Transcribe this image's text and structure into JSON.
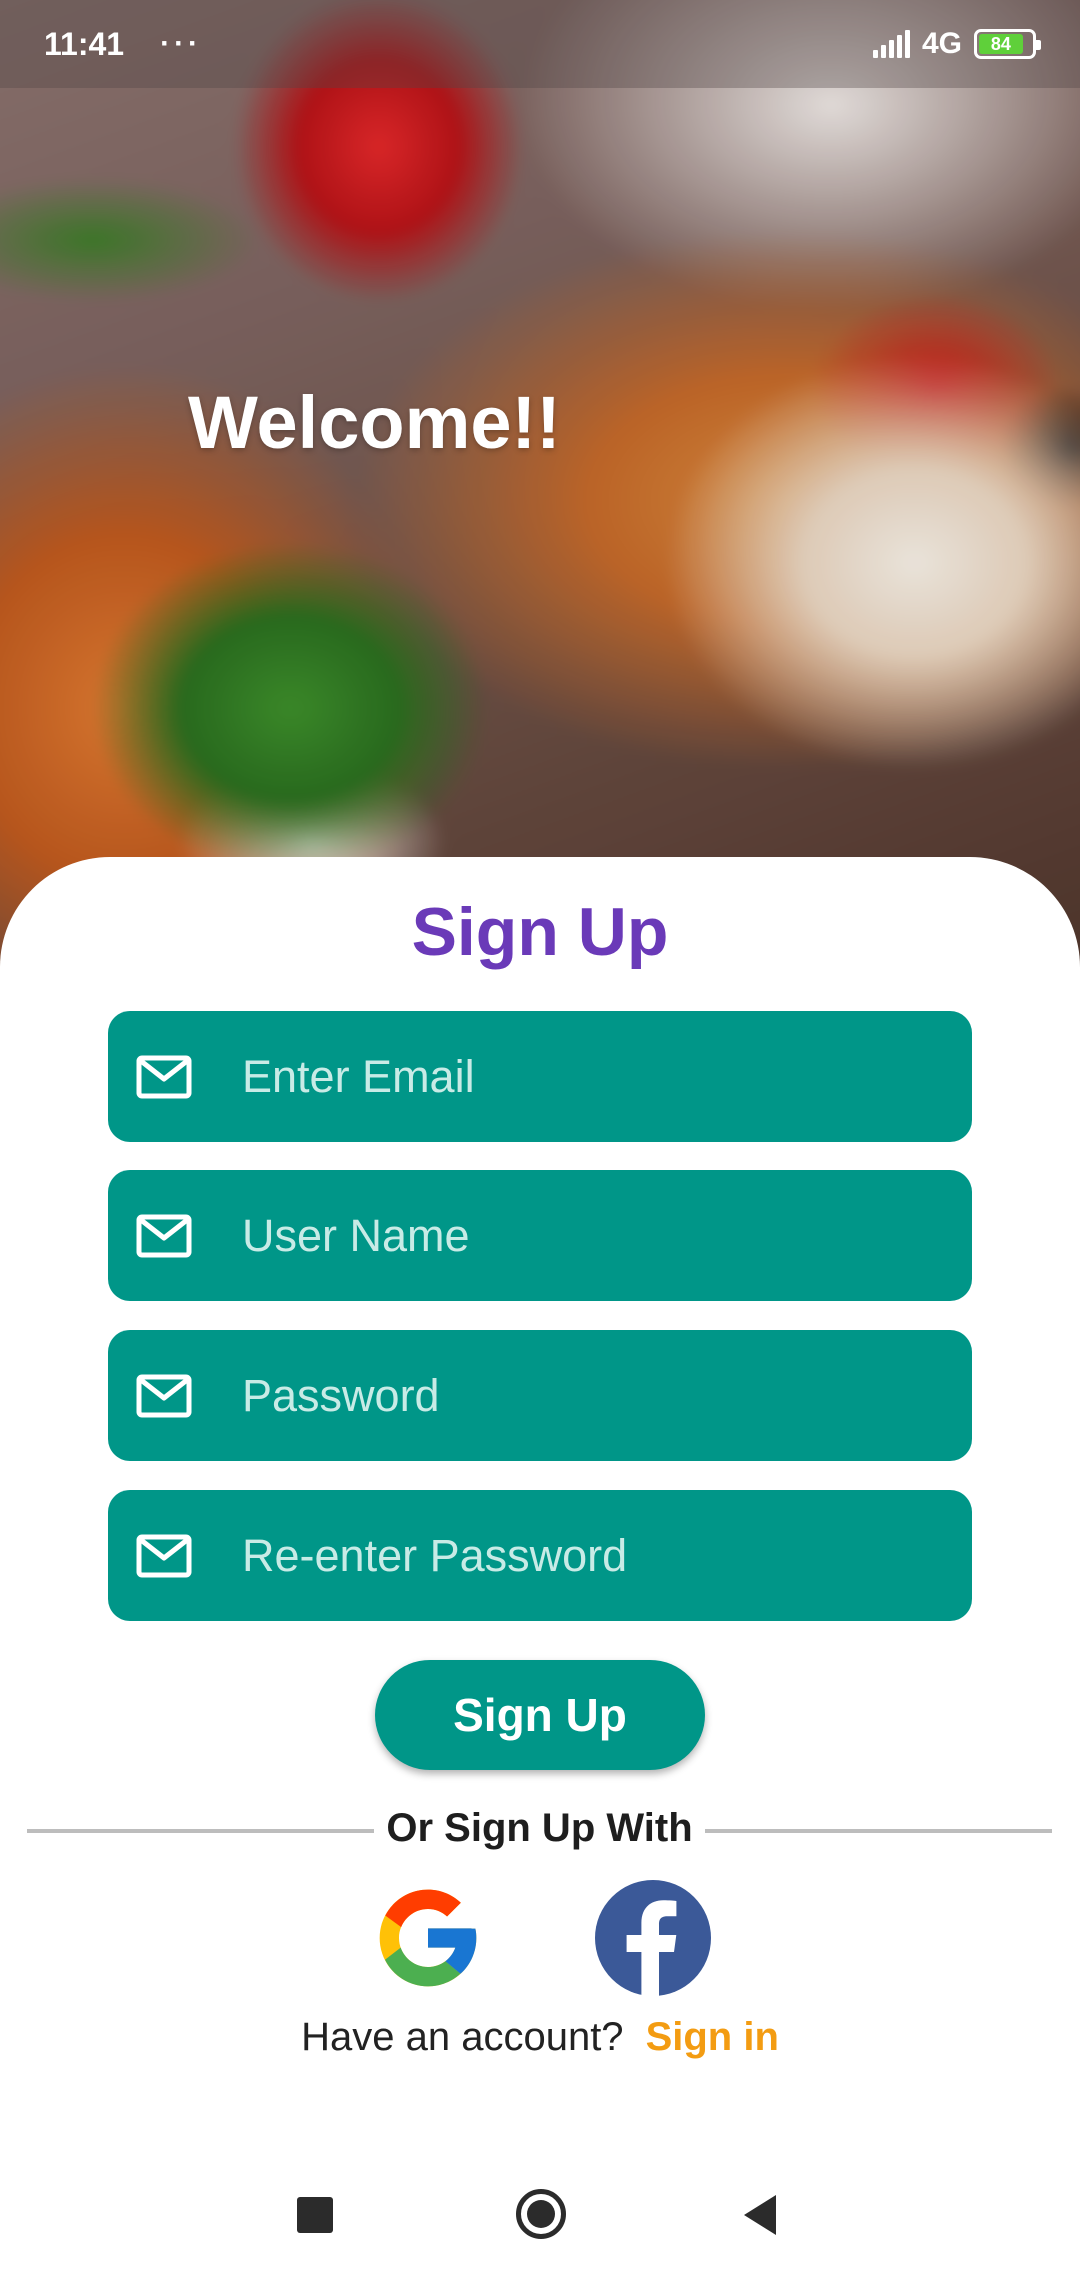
{
  "status_bar": {
    "time": "11:41",
    "dots": "···",
    "network": "4G",
    "battery": "84"
  },
  "hero": {
    "welcome": "Welcome!!"
  },
  "form": {
    "title": "Sign Up",
    "fields": [
      {
        "placeholder": "Enter Email",
        "icon": "mail-icon"
      },
      {
        "placeholder": "User Name",
        "icon": "mail-icon"
      },
      {
        "placeholder": "Password",
        "icon": "mail-icon"
      },
      {
        "placeholder": "Re-enter Password",
        "icon": "mail-icon"
      }
    ],
    "submit_label": "Sign Up"
  },
  "social": {
    "divider_text": "Or Sign Up With",
    "providers": [
      "google-logo",
      "facebook-logo"
    ]
  },
  "footer": {
    "question": "Have an account?",
    "signin_label": "Sign in"
  },
  "colors": {
    "primary": "#009688",
    "title": "#6a3ab8",
    "link": "#f39c12"
  }
}
